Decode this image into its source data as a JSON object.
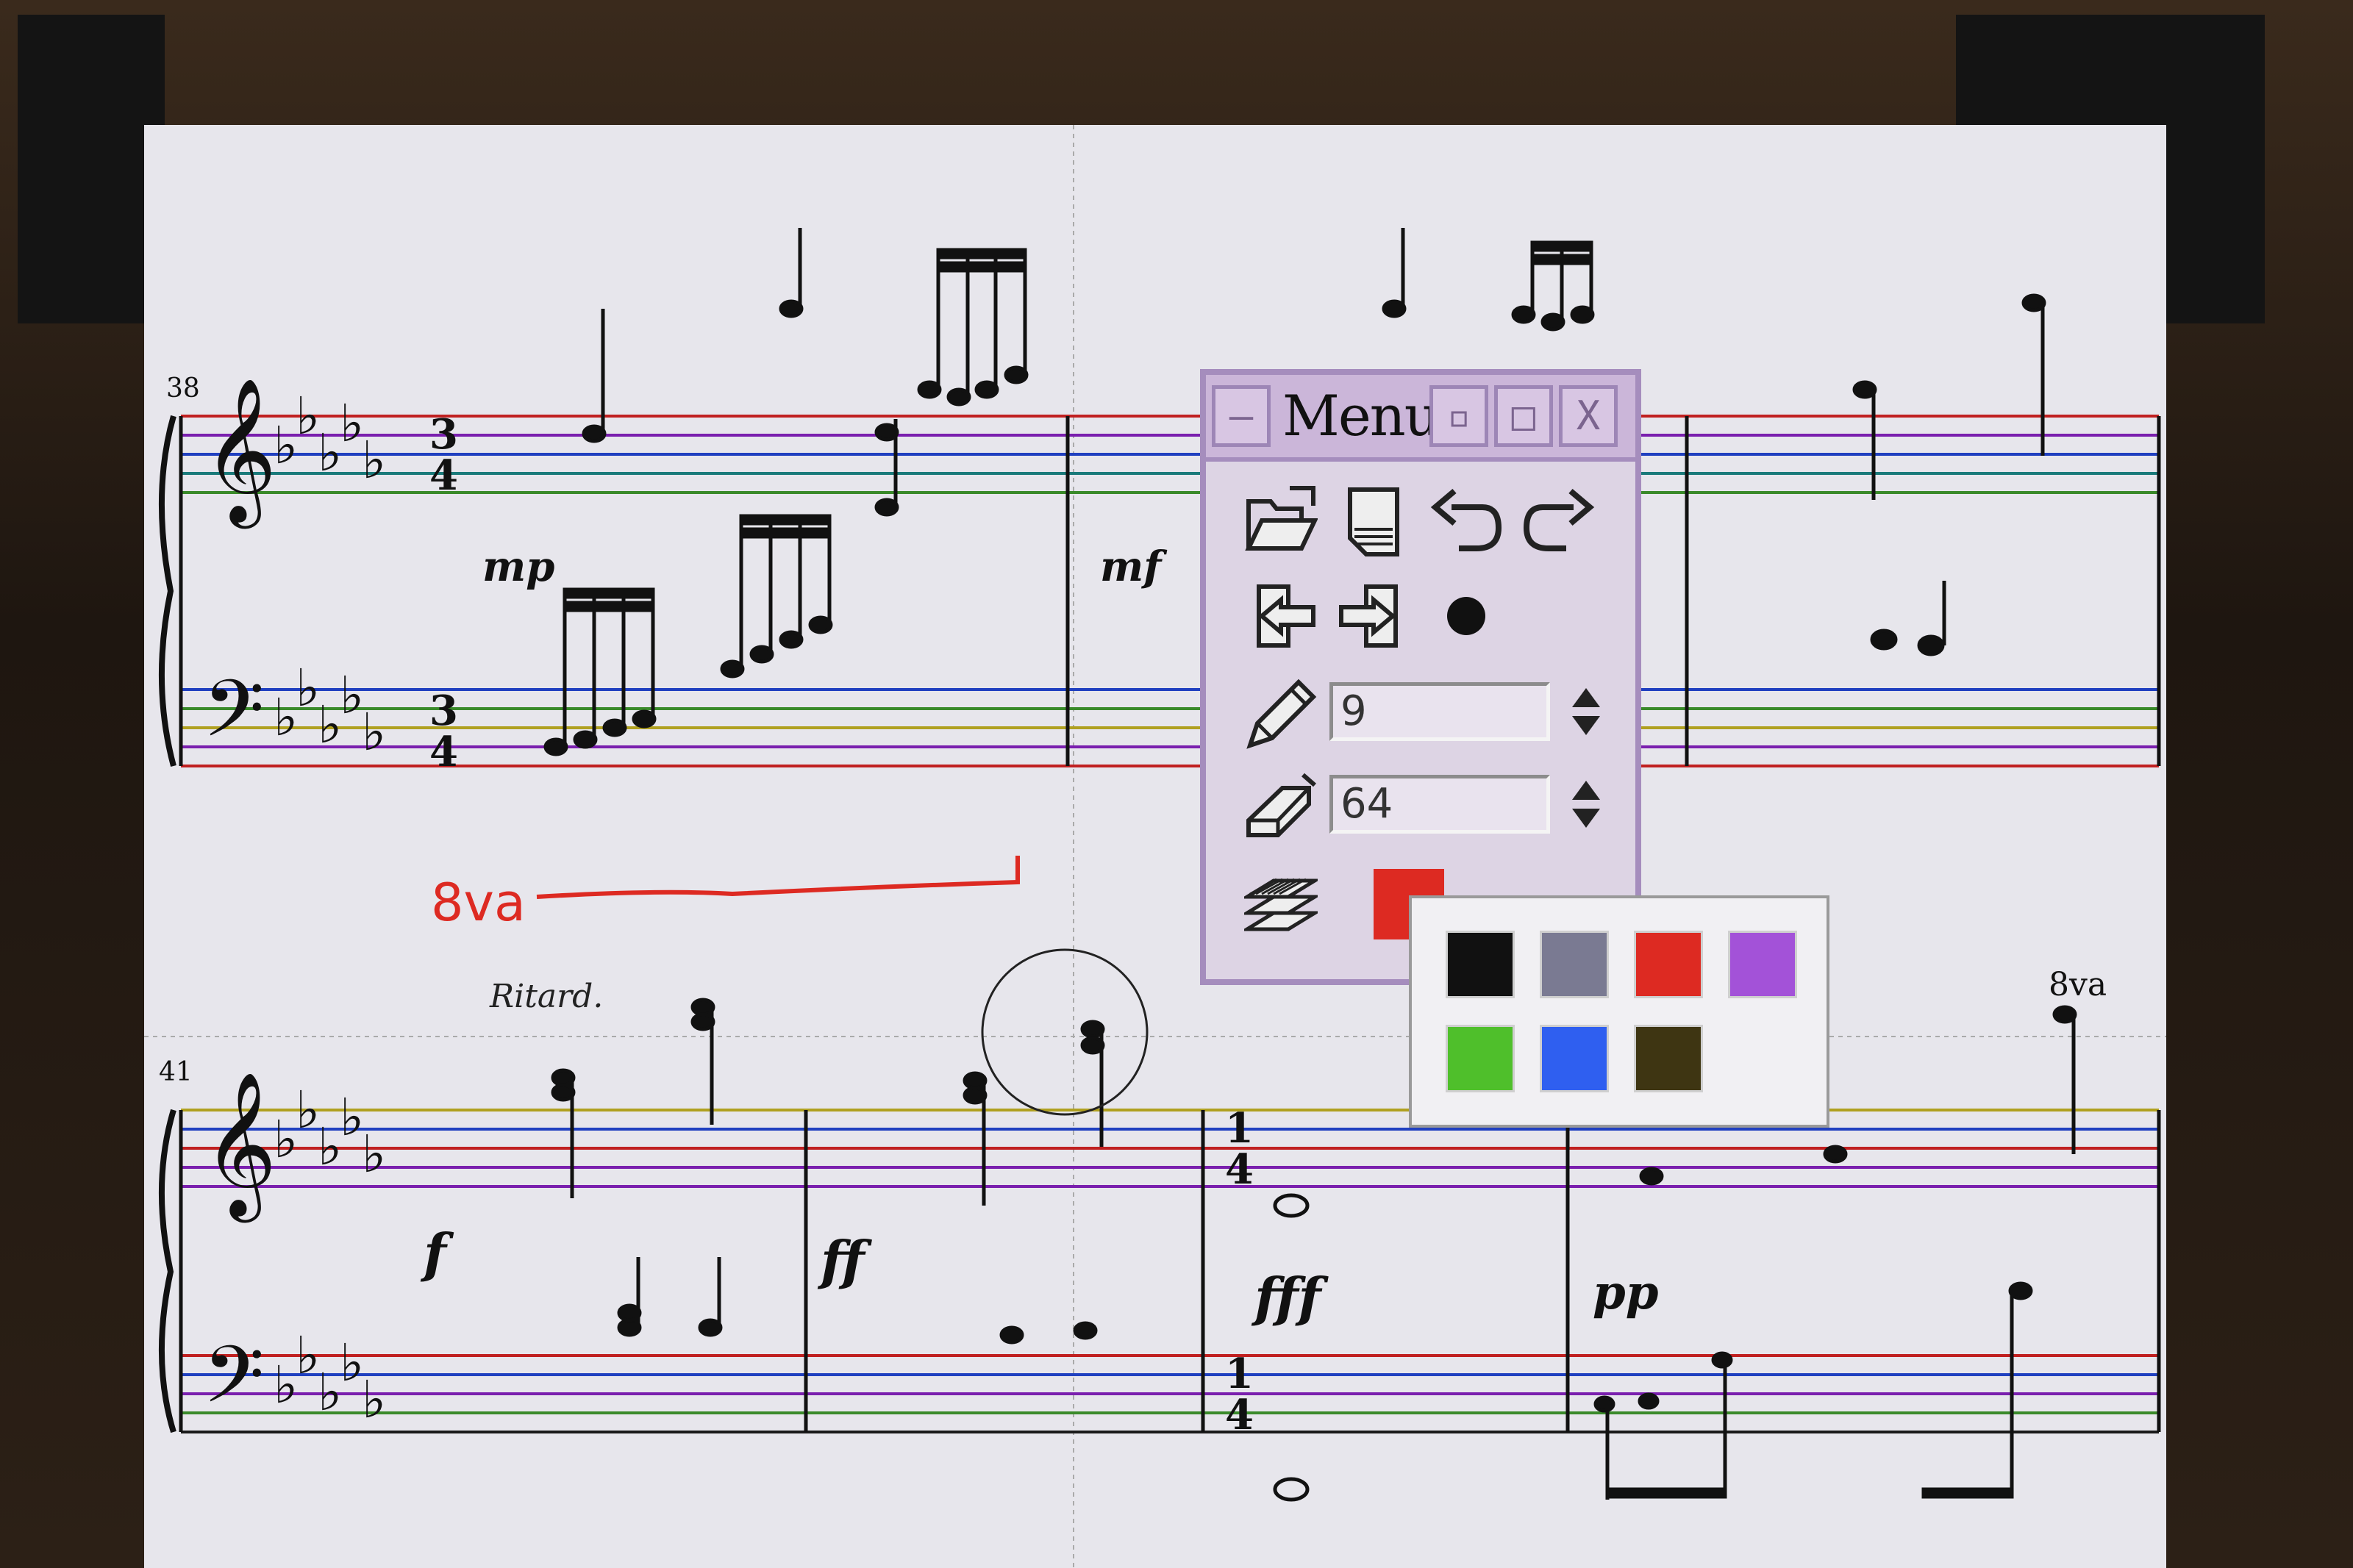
{
  "score": {
    "measure_numbers": [
      "38",
      "41"
    ],
    "dynamics": [
      "mp",
      "mf",
      "f",
      "ff",
      "fff",
      "pp"
    ],
    "tempo_marking": "Ritard.",
    "time_signature_top": "3",
    "time_signature_bottom": "4",
    "time_signature_2_top": "1",
    "time_signature_2_bottom": "4",
    "octave_marking_red": "8va",
    "octave_marking": "8va"
  },
  "menu": {
    "title": "Menu",
    "minimize_label": "—",
    "shade_label": "▫",
    "maximize_label": "□",
    "close_label": "X",
    "pencil_size": "9",
    "eraser_size": "64",
    "current_color": "#dd2a22"
  },
  "palette": {
    "colors": [
      "#111111",
      "#7a7a92",
      "#dd2a22",
      "#a352d8",
      "#4fbf2b",
      "#2f5ff0",
      "#3e3512"
    ]
  },
  "icons": {
    "open": "open-folder-icon",
    "save": "save-icon",
    "undo": "undo-icon",
    "redo": "redo-icon",
    "import": "import-icon",
    "export": "export-icon",
    "record": "record-icon",
    "pencil": "pencil-icon",
    "eraser": "eraser-icon",
    "layers": "layers-icon"
  }
}
